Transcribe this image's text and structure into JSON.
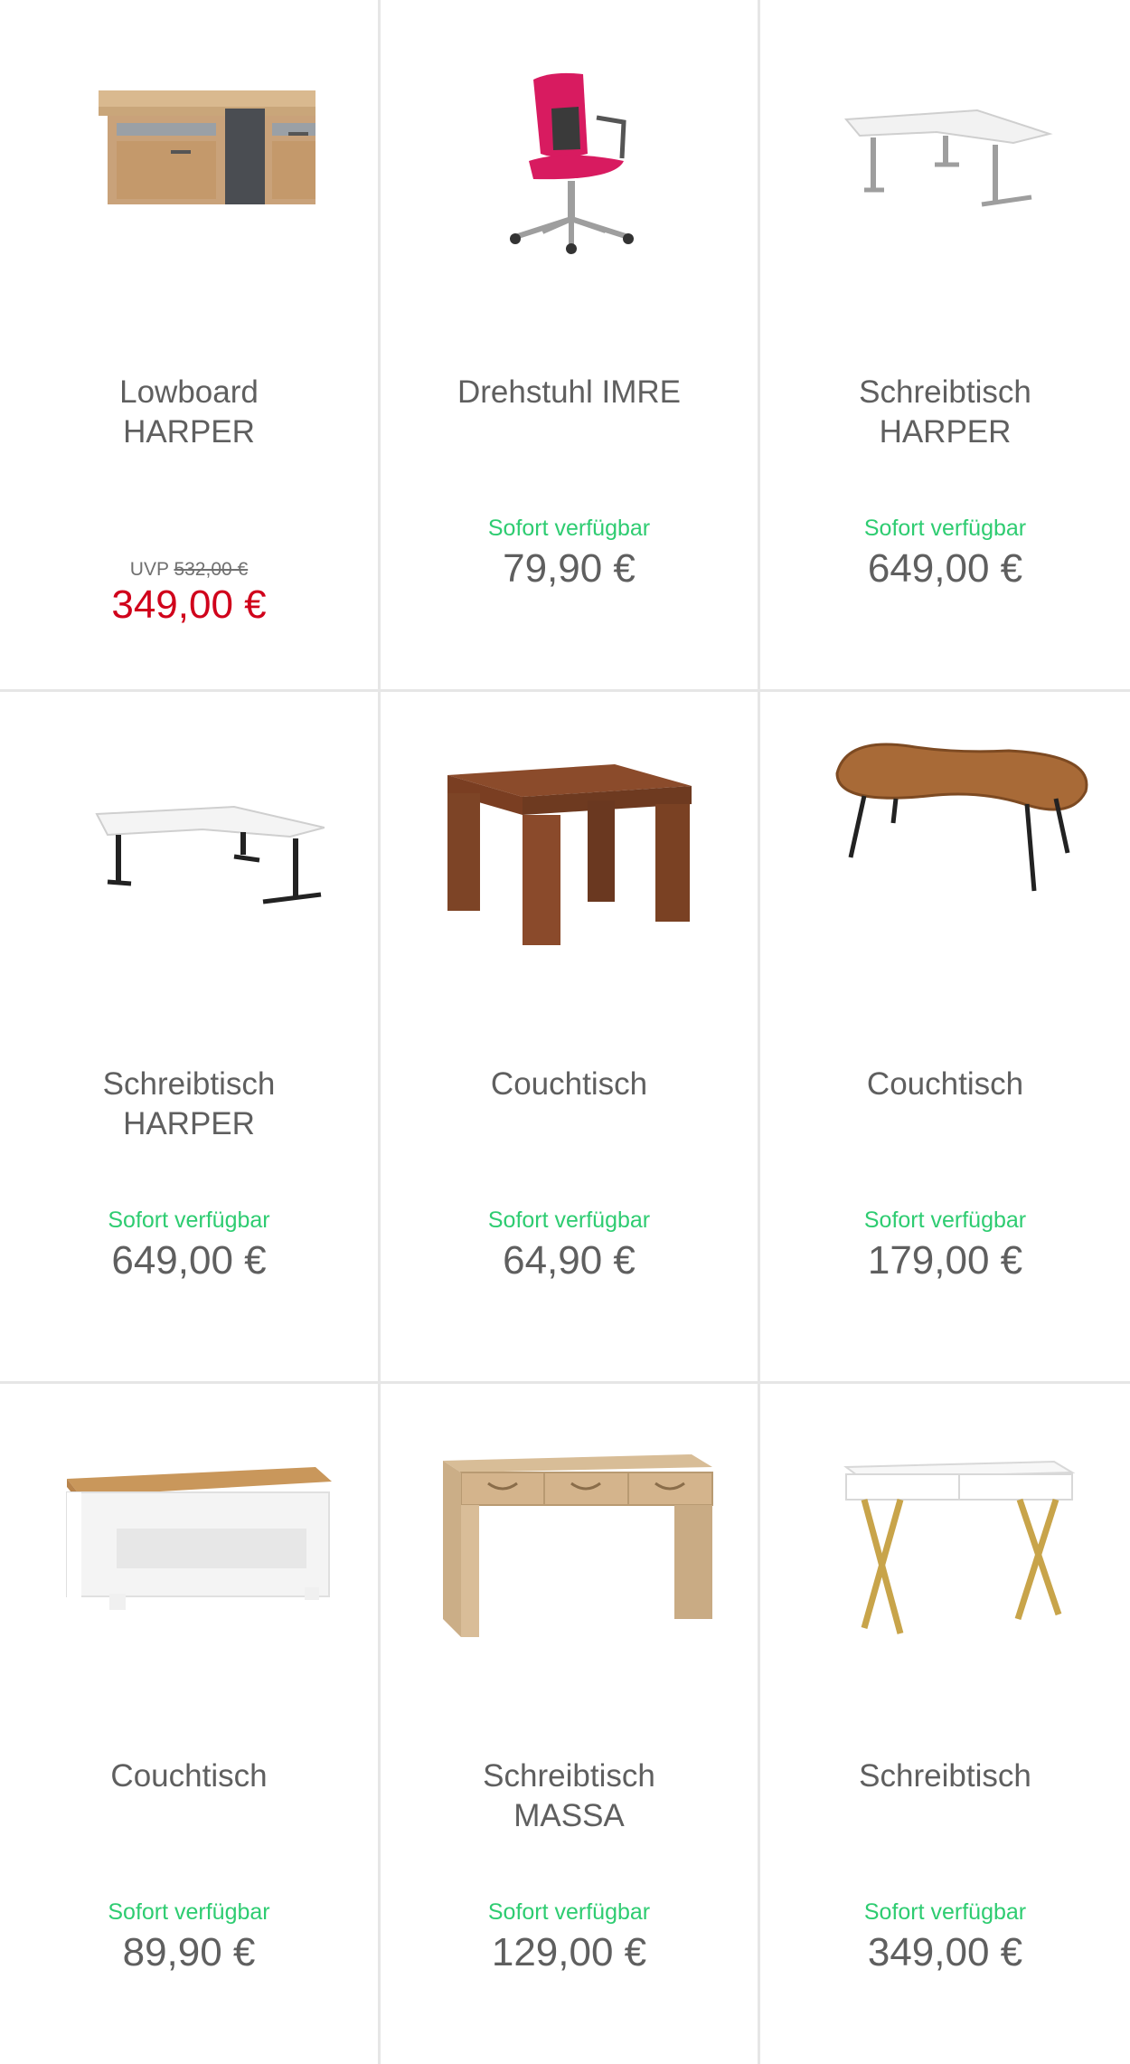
{
  "colors": {
    "available": "#2ecc71",
    "sale_price": "#d0021b",
    "text": "#5f5f5f",
    "divider": "#e6e6e6"
  },
  "products": [
    {
      "image": "lowboard-harper-image",
      "title": "Lowboard\nHARPER",
      "uvp_label": "UVP",
      "uvp_price": "532,00 €",
      "price": "349,00 €"
    },
    {
      "image": "office-chair-image",
      "title": "Drehstuhl IMRE",
      "availability": "Sofort verfügbar",
      "price": "79,90 €"
    },
    {
      "image": "corner-desk-white-image",
      "title": "Schreibtisch\nHARPER",
      "availability": "Sofort verfügbar",
      "price": "649,00 €"
    },
    {
      "image": "corner-desk-black-legs-image",
      "title": "Schreibtisch\nHARPER",
      "availability": "Sofort verfügbar",
      "price": "649,00 €"
    },
    {
      "image": "wooden-side-table-image",
      "title": "Couchtisch",
      "availability": "Sofort verfügbar",
      "price": "64,90 €"
    },
    {
      "image": "kidney-coffee-table-image",
      "title": "Couchtisch",
      "availability": "Sofort verfügbar",
      "price": "179,00 €"
    },
    {
      "image": "white-oak-coffee-table-image",
      "title": "Couchtisch",
      "availability": "Sofort verfügbar",
      "price": "89,90 €"
    },
    {
      "image": "oak-desk-drawers-image",
      "title": "Schreibtisch\nMASSA",
      "availability": "Sofort verfügbar",
      "price": "129,00 €"
    },
    {
      "image": "white-gold-desk-image",
      "title": "Schreibtisch",
      "availability": "Sofort verfügbar",
      "price": "349,00 €"
    }
  ]
}
